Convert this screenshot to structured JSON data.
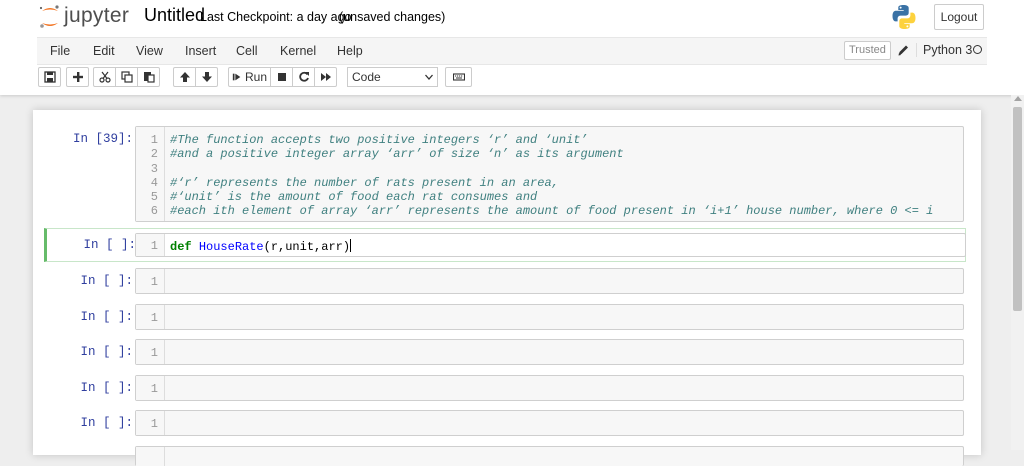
{
  "header": {
    "logo_text": "jupyter",
    "notebook_title": "Untitled",
    "checkpoint": "Last Checkpoint: a day ago",
    "autosave_status": "(unsaved changes)",
    "logout_label": "Logout"
  },
  "menubar": {
    "items": [
      "File",
      "Edit",
      "View",
      "Insert",
      "Cell",
      "Kernel",
      "Help"
    ],
    "trusted_label": "Trusted",
    "kernel_name": "Python 3"
  },
  "toolbar": {
    "run_label": "Run",
    "cell_type": "Code",
    "icons": [
      "save-icon",
      "plus-icon",
      "cut-icon",
      "copy-icon",
      "paste-icon",
      "arrow-up-icon",
      "arrow-down-icon",
      "run-icon",
      "stop-icon",
      "restart-icon",
      "fast-forward-icon",
      "keyboard-icon"
    ]
  },
  "cells": [
    {
      "prompt": "In [39]:",
      "lines": [
        {
          "num": "1",
          "text": "#The function accepts two positive integers ‘r’ and ‘unit’"
        },
        {
          "num": "2",
          "text": "#and a positive integer array ‘arr’ of size ‘n’ as its argument"
        },
        {
          "num": "3",
          "text": ""
        },
        {
          "num": "4",
          "text": "#‘r’ represents the number of rats present in an area,"
        },
        {
          "num": "5",
          "text": "#‘unit’ is the amount of food each rat consumes and"
        },
        {
          "num": "6",
          "text": "#each ith element of array ‘arr’ represents the amount of food present in ‘i+1’ house number, where 0 <= i"
        }
      ]
    },
    {
      "prompt": "In [ ]:",
      "line_num": "1",
      "keyword": "def",
      "func_name": "HouseRate",
      "open_paren": "(",
      "args": "r,unit,arr",
      "close_paren": ")"
    },
    {
      "prompt": "In [ ]:",
      "line_num": "1"
    },
    {
      "prompt": "In [ ]:",
      "line_num": "1"
    },
    {
      "prompt": "In [ ]:",
      "line_num": "1"
    },
    {
      "prompt": "In [ ]:",
      "line_num": "1"
    },
    {
      "prompt": "In [ ]:",
      "line_num": "1"
    }
  ]
}
